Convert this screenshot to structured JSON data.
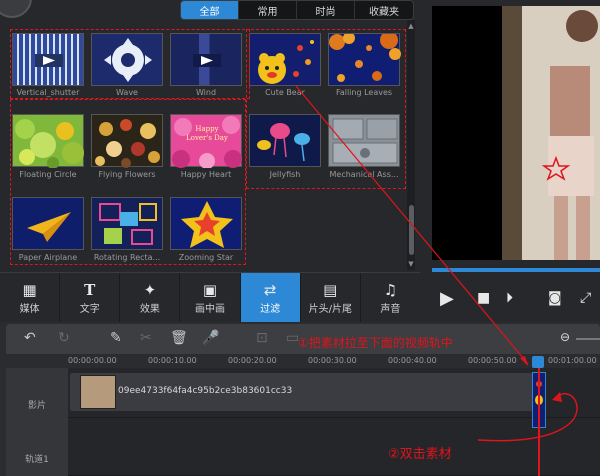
{
  "category_tabs": [
    "全部",
    "常用",
    "时尚",
    "收藏夹"
  ],
  "transitions": [
    {
      "label": "Vertical_shutter",
      "icon": "vertical-shutter-thumb"
    },
    {
      "label": "Wave",
      "icon": "wave-thumb"
    },
    {
      "label": "Wind",
      "icon": "wind-thumb"
    },
    {
      "label": "Cute Bear",
      "icon": "cute-bear-thumb"
    },
    {
      "label": "Falling Leaves",
      "icon": "falling-leaves-thumb"
    },
    {
      "label": "Floating Circle",
      "icon": "floating-circle-thumb"
    },
    {
      "label": "Flying Flowers",
      "icon": "flying-flowers-thumb"
    },
    {
      "label": "Happy Heart",
      "icon": "happy-heart-thumb"
    },
    {
      "label": "Jellyfish",
      "icon": "jellyfish-thumb"
    },
    {
      "label": "Mechanical Ass...",
      "icon": "mechanical-thumb"
    },
    {
      "label": "Paper Airplane",
      "icon": "paper-airplane-thumb"
    },
    {
      "label": "Rotating Recta...",
      "icon": "rotating-rect-thumb"
    },
    {
      "label": "Zooming Star",
      "icon": "zooming-star-thumb"
    }
  ],
  "happy_heart_text": "Happy Lover's Day",
  "toolbar": [
    {
      "label": "媒体",
      "icon": "media-icon"
    },
    {
      "label": "文字",
      "icon": "text-icon"
    },
    {
      "label": "效果",
      "icon": "effects-icon"
    },
    {
      "label": "画中画",
      "icon": "pip-icon"
    },
    {
      "label": "过滤",
      "icon": "transition-icon"
    },
    {
      "label": "片头/片尾",
      "icon": "intro-outro-icon"
    },
    {
      "label": "声音",
      "icon": "audio-icon"
    }
  ],
  "timeline": {
    "ticks": [
      "00:00:00.00",
      "00:00:10.00",
      "00:00:20.00",
      "00:00:30.00",
      "00:00:40.00",
      "00:00:50.00",
      "00:01:00.00"
    ],
    "tracks": [
      "影片",
      "轨道1"
    ],
    "clip_name": "09ee4733f64fa4c95b2ce3b83601cc33"
  },
  "annotations": {
    "step1": "①把素材拉至下面的视频轨中",
    "step2": "②双击素材"
  },
  "colors": {
    "accent": "#2d88d6",
    "annotation": "#e0141c"
  }
}
